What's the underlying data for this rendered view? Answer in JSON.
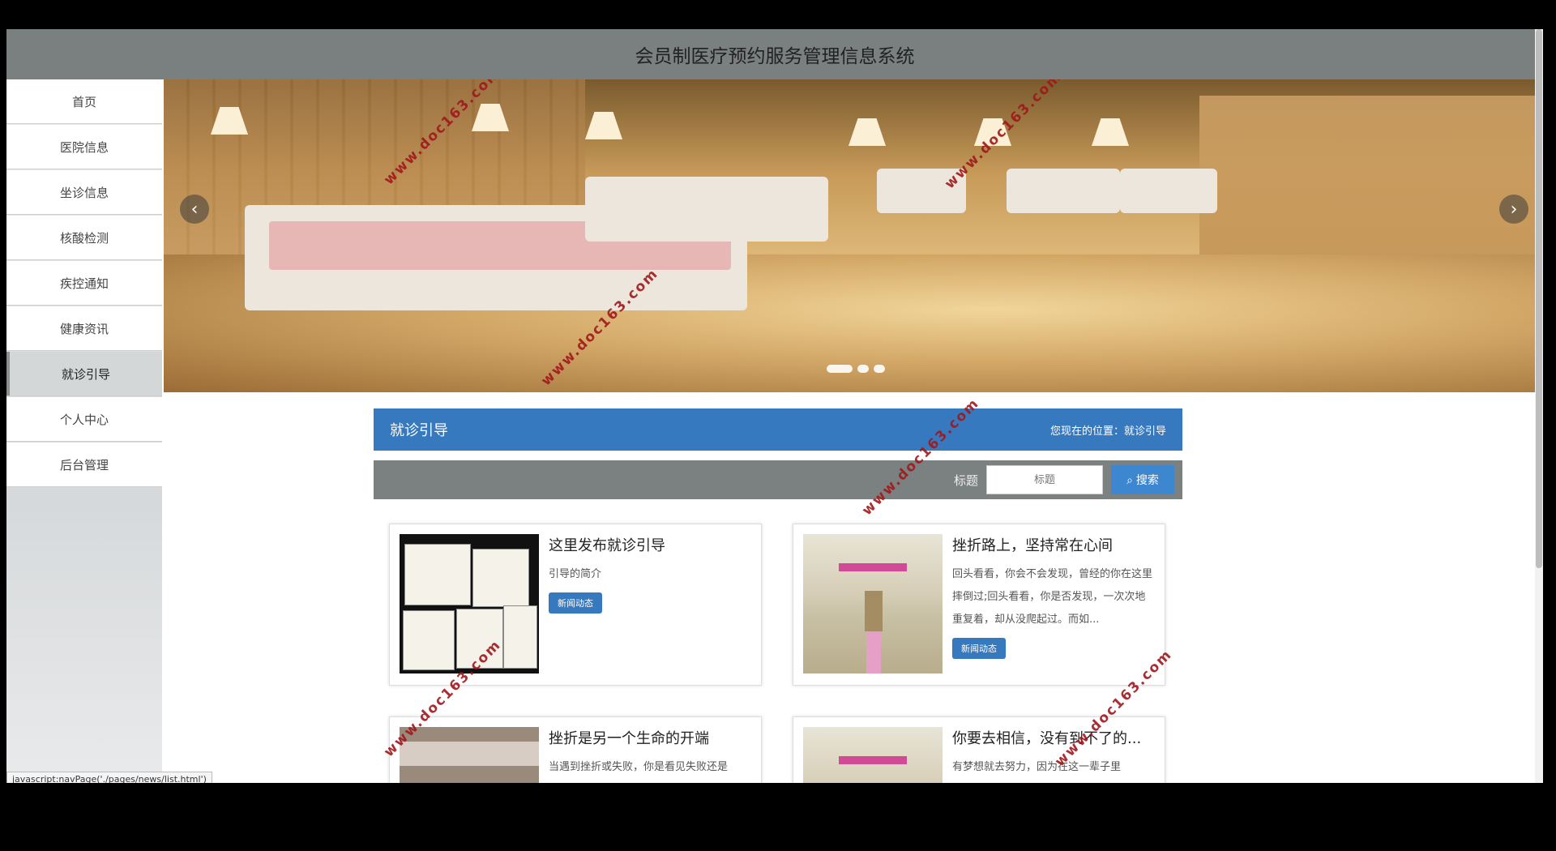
{
  "header": {
    "title": "会员制医疗预约服务管理信息系统"
  },
  "sidebar": {
    "items": [
      {
        "label": "首页"
      },
      {
        "label": "医院信息"
      },
      {
        "label": "坐诊信息"
      },
      {
        "label": "核酸检测"
      },
      {
        "label": "疾控通知"
      },
      {
        "label": "健康资讯"
      },
      {
        "label": "就诊引导",
        "active": true
      },
      {
        "label": "个人中心"
      },
      {
        "label": "后台管理"
      }
    ]
  },
  "carousel": {
    "prev_icon": "chevron-left-icon",
    "next_icon": "chevron-right-icon",
    "slide_count": 3,
    "active_index": 0
  },
  "section": {
    "title": "就诊引导",
    "location": "您现在的位置：就诊引导"
  },
  "search": {
    "label": "标题",
    "placeholder": "标题",
    "value": "",
    "button_label": "搜索",
    "button_icon": "search-icon"
  },
  "articles": [
    {
      "title": "这里发布就诊引导",
      "desc": "引导的简介",
      "tag": "新闻动态"
    },
    {
      "title": "挫折路上，坚持常在心间",
      "desc": "回头看看，你会不会发现，曾经的你在这里摔倒过;回头看看，你是否发现，一次次地重复着，却从没爬起过。而如...",
      "tag": "新闻动态"
    },
    {
      "title": "挫折是另一个生命的开端",
      "desc": "当遇到挫折或失败，你是看见失败还是",
      "tag": ""
    },
    {
      "title": "你要去相信，没有到不了的...",
      "desc": "有梦想就去努力，因为在这一辈子里",
      "tag": ""
    }
  ],
  "watermark": "www.doc163.com",
  "status_url": "javascript:navPage('./pages/news/list.html')",
  "colors": {
    "header_bg": "#7a7f7f",
    "accent": "#3779bf",
    "searchbar_bg": "#7b8080"
  }
}
